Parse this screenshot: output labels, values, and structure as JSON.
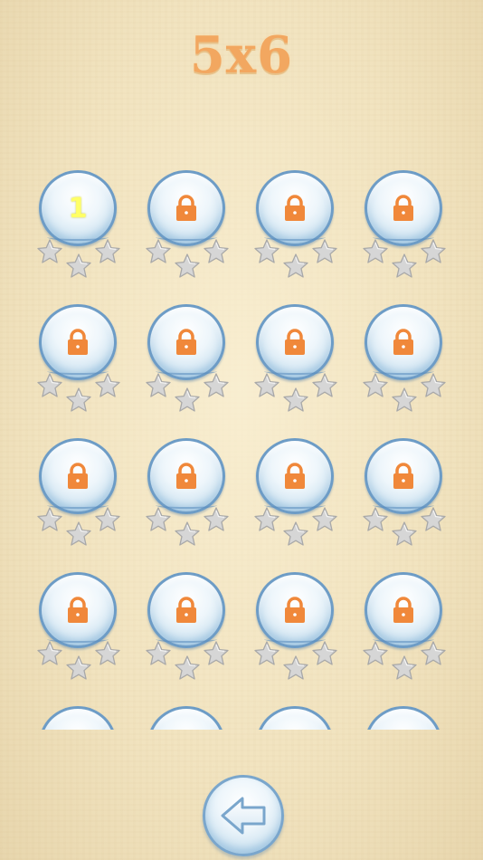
{
  "header": {
    "title": "5x6"
  },
  "levels": [
    {
      "label": "1",
      "locked": false,
      "stars": 0
    },
    {
      "label": "",
      "locked": true,
      "stars": 0
    },
    {
      "label": "",
      "locked": true,
      "stars": 0
    },
    {
      "label": "",
      "locked": true,
      "stars": 0
    },
    {
      "label": "",
      "locked": true,
      "stars": 0
    },
    {
      "label": "",
      "locked": true,
      "stars": 0
    },
    {
      "label": "",
      "locked": true,
      "stars": 0
    },
    {
      "label": "",
      "locked": true,
      "stars": 0
    },
    {
      "label": "",
      "locked": true,
      "stars": 0
    },
    {
      "label": "",
      "locked": true,
      "stars": 0
    },
    {
      "label": "",
      "locked": true,
      "stars": 0
    },
    {
      "label": "",
      "locked": true,
      "stars": 0
    },
    {
      "label": "",
      "locked": true,
      "stars": 0
    },
    {
      "label": "",
      "locked": true,
      "stars": 0
    },
    {
      "label": "",
      "locked": true,
      "stars": 0
    },
    {
      "label": "",
      "locked": true,
      "stars": 0
    },
    {
      "label": "",
      "locked": true,
      "stars": 0
    },
    {
      "label": "",
      "locked": true,
      "stars": 0
    },
    {
      "label": "",
      "locked": true,
      "stars": 0
    },
    {
      "label": "",
      "locked": true,
      "stars": 0
    }
  ],
  "icons": {
    "lock": "lock-icon",
    "star": "star-icon",
    "back": "back-arrow-icon"
  },
  "colors": {
    "title": "#f2a760",
    "lock": "#f0883a",
    "star_empty": "#d6d6d6",
    "level_number": "#ffff66",
    "bubble_border": "#6d9cc6"
  }
}
